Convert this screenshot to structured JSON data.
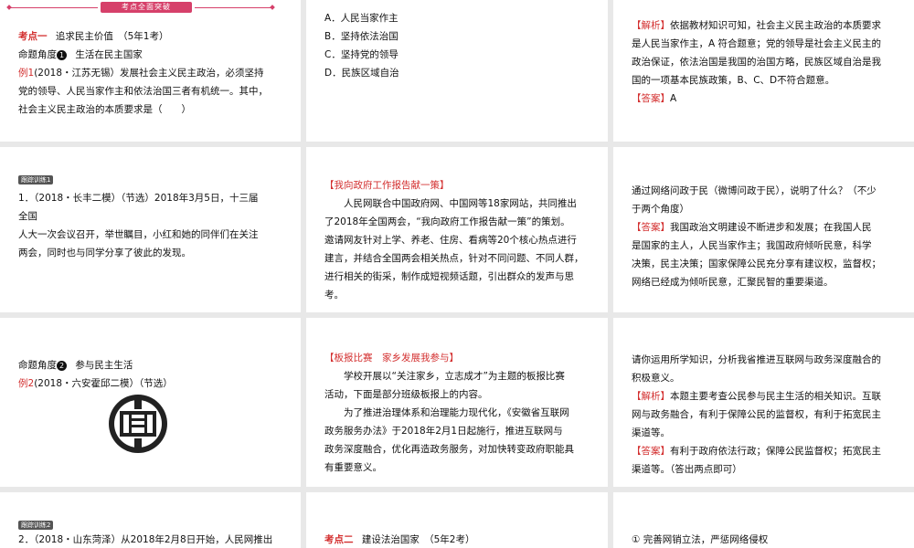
{
  "row1": {
    "banner": "考点全面突破",
    "left": {
      "kaodian_label": "考点一",
      "kaodian_text": "追求民主价值　（5年1考）",
      "mingti_label": "命题角度",
      "mingti_num": "1",
      "mingti_text": "生活在民主国家",
      "example_label": "例1",
      "example_lines": [
        "(2018・江苏无锡）发展社会主义民主政治，必须坚持",
        "党的领导、人民当家作主和依法治国三者有机统一。其中，",
        "社会主义民主政治的本质要求是（　　）"
      ]
    },
    "middle": {
      "options": [
        "A．人民当家作主",
        "B．坚持依法治国",
        "C．坚持党的领导",
        "D．民族区域自治"
      ]
    },
    "right": {
      "jiexi_label": "【解析】",
      "jiexi_lines": [
        "依据教材知识可知，社会主义民主政治的本质要求",
        "是人民当家作主，A 符合题意；党的领导是社会主义民主的",
        "政治保证，依法治国是我国的治国方略，民族区域自治是我",
        "国的一项基本民族政策，B、C、D不符合题意。"
      ],
      "answer_label": "【答案】",
      "answer_text": "A"
    }
  },
  "row2": {
    "left": {
      "track_label": "跟踪训练",
      "track_num": "1",
      "lines": [
        "1．（2018・长丰二模）（节选）2018年3月5日，十三届",
        "全国",
        "人大一次会议召开，举世瞩目，小红和她的同伴们在关注",
        "两会，同时也与同学分享了彼此的发现。"
      ]
    },
    "middle": {
      "title": "【我向政府工作报告献一策】",
      "lines": [
        "人民网联合中国政府网、中国网等18家网站，共同推出",
        "了2018年全国两会，“我向政府工作报告献一策”的策划。",
        "邀请网友针对上学、养老、住房、看病等20个核心热点进行",
        "建言，并结合全国两会相关热点，针对不同问题、不同人群，",
        "进行相关的街采，制作成短视频话题，引出群众的发声与思",
        "考。"
      ]
    },
    "right": {
      "question_lines": [
        "通过网络问政于民（微博问政于民），说明了什么？（不少",
        "于两个角度）"
      ],
      "answer_label": "【答案】",
      "answer_lines": [
        "我国政治文明建设不断进步和发展；在我国人民",
        "是国家的主人，人民当家作主；我国政府倾听民意，科学",
        "决策，民主决策；国家保障公民充分享有建议权，监督权；",
        "网络已经成为倾听民意，汇聚民智的重要渠道。"
      ]
    }
  },
  "row3": {
    "left": {
      "mingti_label": "命题角度",
      "mingti_num": "2",
      "mingti_text": "参与民主生活",
      "example_label": "例2",
      "example_text": "(2018・六安霍邱二模）（节选）"
    },
    "middle": {
      "title": "【板报比赛　家乡发展我参与】",
      "lines": [
        "学校开展以“关注家乡，立志成才”为主题的板报比赛",
        "活动，下面是部分班级板报上的内容。",
        "为了推进治理体系和治理能力现代化，《安徽省互联网",
        "政务服务办法》于2018年2月1日起施行，推进互联网与",
        "政务深度融合，优化再造政务服务，对加快转变政府职能具",
        "有重要意义。"
      ]
    },
    "right": {
      "question_lines": [
        "请你运用所学知识，分析我省推进互联网与政务深度融合的",
        "积极意义。"
      ],
      "jiexi_label": "【解析】",
      "jiexi_lines": [
        "本题主要考查公民参与民主生活的相关知识。互联",
        "网与政务融合，有利于保障公民的监督权，有利于拓宽民主",
        "渠道等。"
      ],
      "answer_label": "【答案】",
      "answer_lines": [
        "有利于政府依法行政；保障公民监督权；拓宽民主",
        "渠道等。（答出两点即可）"
      ]
    }
  },
  "row4": {
    "left": {
      "track_label": "跟踪训练",
      "track_num": "2",
      "line": "2．（2018・山东菏泽）从2018年2月8日开始，人民网推出"
    },
    "middle": {
      "kaodian_label": "考点二",
      "kaodian_text": "建设法治国家　（5年2考）"
    },
    "right": {
      "line": "① 完善网销立法，严惩网络侵权"
    }
  }
}
